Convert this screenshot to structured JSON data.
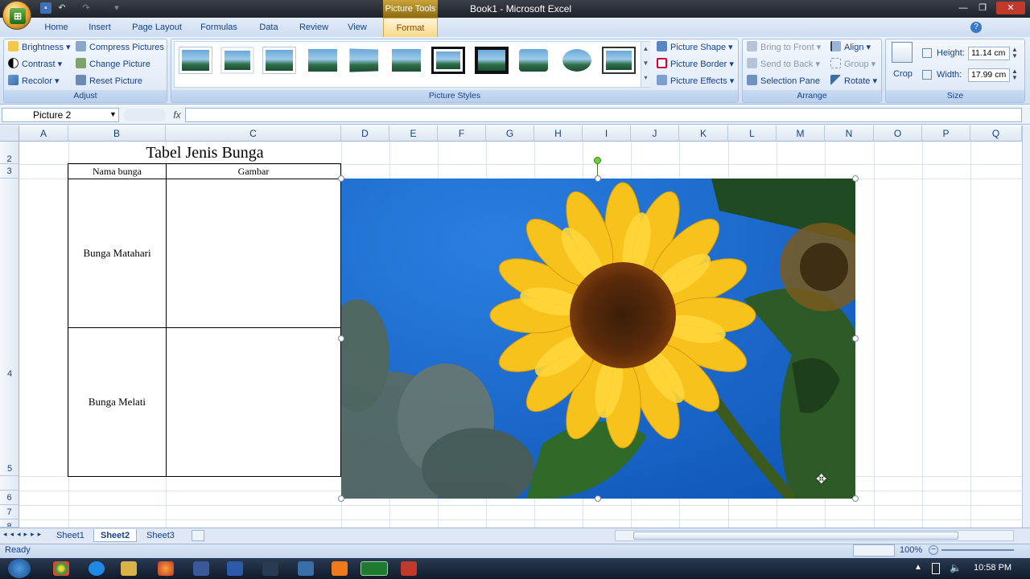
{
  "titlebar": {
    "context_tab": "Picture Tools",
    "window_title": "Book1 - Microsoft Excel"
  },
  "tabs": [
    "Home",
    "Insert",
    "Page Layout",
    "Formulas",
    "Data",
    "Review",
    "View",
    "Format"
  ],
  "ribbon": {
    "adjust": {
      "label": "Adjust",
      "brightness": "Brightness",
      "contrast": "Contrast",
      "recolor": "Recolor",
      "compress": "Compress Pictures",
      "change": "Change Picture",
      "reset": "Reset Picture"
    },
    "styles": {
      "label": "Picture Styles",
      "shape": "Picture Shape",
      "border": "Picture Border",
      "effects": "Picture Effects"
    },
    "arrange": {
      "label": "Arrange",
      "bring_front": "Bring to Front",
      "send_back": "Send to Back",
      "selection_pane": "Selection Pane",
      "align": "Align",
      "group": "Group",
      "rotate": "Rotate"
    },
    "size": {
      "label": "Size",
      "crop": "Crop",
      "height_label": "Height:",
      "height_value": "11.14 cm",
      "width_label": "Width:",
      "width_value": "17.99 cm"
    }
  },
  "formula_bar": {
    "name_box": "Picture 2",
    "fx": "fx"
  },
  "columns": [
    "A",
    "B",
    "C",
    "D",
    "E",
    "F",
    "G",
    "H",
    "I",
    "J",
    "K",
    "L",
    "M",
    "N",
    "O",
    "P",
    "Q"
  ],
  "rows": [
    "2",
    "3",
    "4",
    "5",
    "6",
    "7",
    "8"
  ],
  "sheet": {
    "title": "Tabel Jenis Bunga",
    "header_name": "Nama bunga",
    "header_image": "Gambar",
    "row1": "Bunga Matahari",
    "row2": "Bunga Melati"
  },
  "sheet_tabs": [
    "Sheet1",
    "Sheet2",
    "Sheet3"
  ],
  "status": {
    "ready": "Ready",
    "zoom": "100%"
  },
  "taskbar": {
    "time": "10:58 PM"
  },
  "colors": {
    "accent": "#15428b",
    "format_tab": "#f9d98b",
    "sky": "#1e6fd4",
    "petal": "#f6c21b"
  }
}
